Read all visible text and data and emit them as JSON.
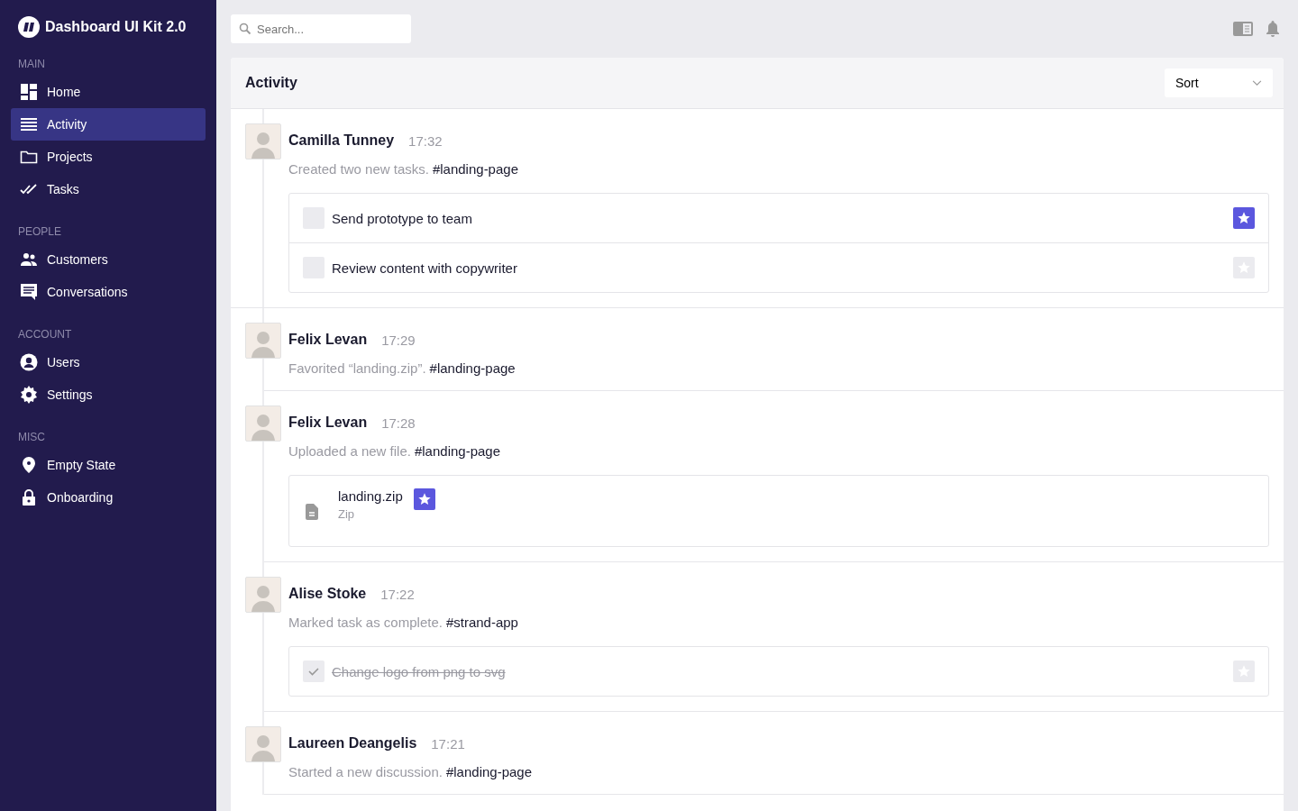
{
  "sidebar": {
    "brand": "Dashboard UI Kit 2.0",
    "sections": [
      {
        "heading": "MAIN",
        "items": [
          {
            "label": "Home",
            "selected": false
          },
          {
            "label": "Activity",
            "selected": true
          },
          {
            "label": "Projects",
            "selected": false
          },
          {
            "label": "Tasks",
            "selected": false
          }
        ]
      },
      {
        "heading": "PEOPLE",
        "items": [
          {
            "label": "Customers",
            "selected": false
          },
          {
            "label": "Conversations",
            "selected": false
          }
        ]
      },
      {
        "heading": "ACCOUNT",
        "items": [
          {
            "label": "Users",
            "selected": false
          },
          {
            "label": "Settings",
            "selected": false
          }
        ]
      },
      {
        "heading": "MISC",
        "items": [
          {
            "label": "Empty State",
            "selected": false
          },
          {
            "label": "Onboarding",
            "selected": false
          }
        ]
      }
    ]
  },
  "search": {
    "placeholder": "Search..."
  },
  "panel": {
    "title": "Activity",
    "sort": "Sort"
  },
  "feed": [
    {
      "name": "Camilla Tunney",
      "time": "17:32",
      "text": "Created two new tasks.",
      "tag": "#landing-page",
      "kind": "tasks",
      "tasks": [
        {
          "label": "Send prototype to team",
          "checked": false,
          "starred": true
        },
        {
          "label": "Review content with copywriter",
          "checked": false,
          "starred": false
        }
      ]
    },
    {
      "name": "Felix Levan",
      "time": "17:29",
      "text": "Favorited “landing.zip”.",
      "tag": "#landing-page",
      "kind": "none"
    },
    {
      "name": "Felix Levan",
      "time": "17:28",
      "text": "Uploaded a new file.",
      "tag": "#landing-page",
      "kind": "file",
      "file": {
        "name": "landing.zip",
        "type": "Zip",
        "starred": true
      }
    },
    {
      "name": "Alise Stoke",
      "time": "17:22",
      "text": "Marked task as complete.",
      "tag": "#strand-app",
      "kind": "tasks",
      "tasks": [
        {
          "label": "Change logo from png to svg",
          "checked": true,
          "starred": false
        }
      ]
    },
    {
      "name": "Laureen Deangelis",
      "time": "17:21",
      "text": "Started a new discussion.",
      "tag": "#landing-page",
      "kind": "none"
    }
  ]
}
